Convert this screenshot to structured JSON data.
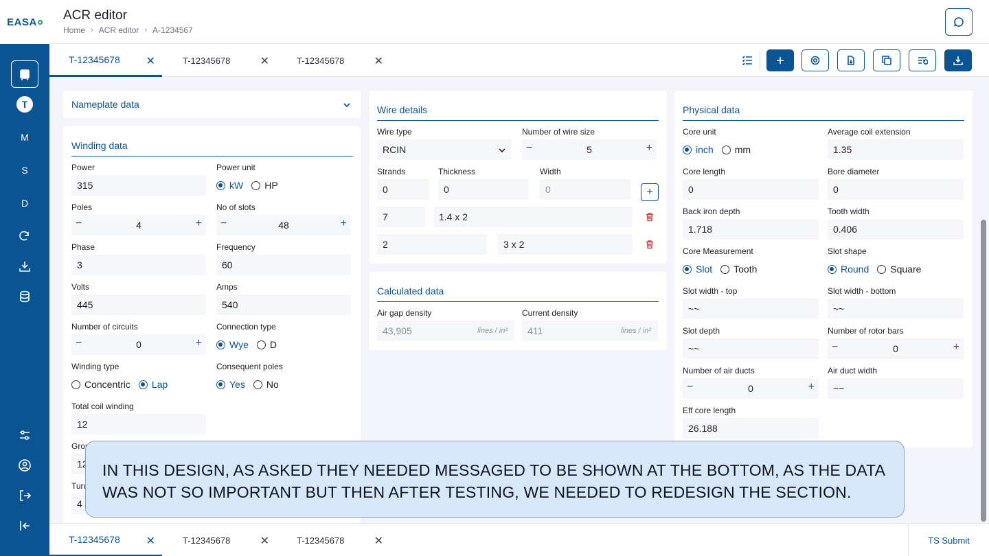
{
  "brand": {
    "logo_text": "EASA"
  },
  "sidebar": {
    "items": [
      {
        "name": "editor",
        "label": "",
        "active": true
      },
      {
        "name": "T",
        "label": "T"
      },
      {
        "name": "M",
        "label": "M"
      },
      {
        "name": "S",
        "label": "S"
      },
      {
        "name": "D",
        "label": "D"
      }
    ]
  },
  "header": {
    "title": "ACR editor",
    "breadcrumb": [
      "Home",
      "ACR editor",
      "A-1234567"
    ]
  },
  "tabs": [
    {
      "label": "T-12345678",
      "active": true
    },
    {
      "label": "T-12345678",
      "active": false
    },
    {
      "label": "T-12345678",
      "active": false
    }
  ],
  "bottom_tabs": [
    {
      "label": "T-12345678",
      "active": true
    },
    {
      "label": "T-12345678",
      "active": false
    },
    {
      "label": "T-12345678",
      "active": false
    }
  ],
  "bottom_bar": {
    "submit_label": "TS Submit"
  },
  "nameplate": {
    "title": "Nameplate data"
  },
  "winding": {
    "title": "Winding data",
    "power_label": "Power",
    "power_value": "315",
    "power_unit_label": "Power unit",
    "power_unit_options": [
      "kW",
      "HP"
    ],
    "poles_label": "Poles",
    "poles_value": "4",
    "slots_label": "No of slots",
    "slots_value": "48",
    "phase_label": "Phase",
    "phase_value": "3",
    "frequency_label": "Frequency",
    "frequency_value": "60",
    "volts_label": "Volts",
    "volts_value": "445",
    "amps_label": "Amps",
    "amps_value": "540",
    "circuits_label": "Number of circuits",
    "circuits_value": "0",
    "connection_label": "Connection type",
    "connection_options": [
      "Wye",
      "D"
    ],
    "winding_type_label": "Winding type",
    "winding_type_options": [
      "Concentric",
      "Lap"
    ],
    "consequent_label": "Consequent poles",
    "consequent_options": [
      "Yes",
      "No"
    ],
    "total_coil_label": "Total coil winding",
    "total_coil_value": "12",
    "group_label": "Grou",
    "group_value": "12",
    "turns_label": "Turı",
    "turns_value": "4"
  },
  "wire": {
    "title": "Wire details",
    "wire_type_label": "Wire type",
    "wire_type_value": "RCIN",
    "wire_size_label": "Number of wire size",
    "wire_size_value": "5",
    "strands_label": "Strands",
    "thickness_label": "Thickness",
    "width_label": "Width",
    "new_strands": "0",
    "new_thickness": "0",
    "new_width": "0",
    "rows": [
      {
        "strands": "7",
        "size": "1.4 x 2"
      },
      {
        "strands": "2",
        "size": "3 x 2"
      }
    ]
  },
  "calculated": {
    "title": "Calculated data",
    "air_gap_label": "Air gap density",
    "air_gap_value": "43,905",
    "current_label": "Current density",
    "current_value": "411",
    "unit": "lines / in²"
  },
  "physical": {
    "title": "Physical data",
    "core_unit_label": "Core unit",
    "core_unit_options": [
      "inch",
      "mm"
    ],
    "avg_coil_label": "Average coil extension",
    "avg_coil_value": "1.35",
    "core_length_label": "Core length",
    "core_length_value": "0",
    "bore_label": "Bore diameter",
    "bore_value": "0",
    "back_iron_label": "Back iron depth",
    "back_iron_value": "1.718",
    "tooth_width_label": "Tooth width",
    "tooth_width_value": "0.406",
    "core_measure_label": "Core Measurement",
    "core_measure_options": [
      "Slot",
      "Tooth"
    ],
    "slot_shape_label": "Slot shape",
    "slot_shape_options": [
      "Round",
      "Square"
    ],
    "slot_top_label": "Slot width - top",
    "slot_top_value": "~~",
    "slot_bottom_label": "Slot width - bottom",
    "slot_bottom_value": "~~",
    "slot_depth_label": "Slot depth",
    "slot_depth_value": "~~",
    "rotor_bars_label": "Number of rotor bars",
    "rotor_bars_value": "0",
    "air_ducts_label": "Number of air ducts",
    "air_ducts_value": "0",
    "air_duct_width_label": "Air duct width",
    "air_duct_width_value": "~~",
    "eff_core_label": "Eff core length",
    "eff_core_value": "26.188"
  },
  "annotation": {
    "text": "IN THIS DESIGN, AS ASKED THEY NEEDED MESSAGED TO BE SHOWN AT THE BOTTOM, AS THE DATA WAS NOT SO IMPORTANT BUT THEN AFTER TESTING, WE NEEDED TO REDESIGN THE SECTION."
  },
  "colors": {
    "primary": "#0b5494",
    "danger": "#d64545",
    "background": "#f3f5fb"
  }
}
